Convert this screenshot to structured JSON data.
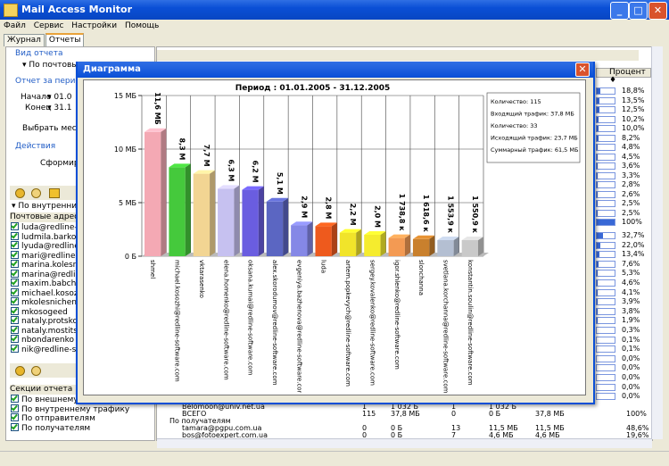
{
  "window": {
    "title": "Mail Access Monitor"
  },
  "menu": [
    "Файл",
    "Сервис",
    "Настройки",
    "Помощь"
  ],
  "tabs": [
    {
      "label": "Журнал"
    },
    {
      "label": "Отчеты"
    }
  ],
  "left": {
    "report_type_header": "Вид отчета",
    "report_type_value": "По почтовым",
    "period_header": "Отчет за период",
    "start_label": "Начало",
    "start_value": "01.0",
    "end_label": "Конец",
    "end_value": "31.1",
    "choose_month": "Выбрать месяц",
    "actions_header": "Действия",
    "generate": "Сформиров",
    "filter_value": "По внутренни",
    "addresses_header": "Почтовые адреса",
    "addresses": [
      "luda@redline-s",
      "ludmila.barkov",
      "lyuda@redline-s",
      "mari@redline-s",
      "marina.kolesnic",
      "marina@redline-",
      "maxim.babcher",
      "michael.kosozh",
      "mkolesnichenko",
      "mkosogeed",
      "nataly.protsko",
      "nataly.mostits",
      "nbondarenko",
      "nik@redline-so"
    ],
    "sections_header": "Секции отчета",
    "sections": [
      "По внешнему",
      "По внутреннему трафику",
      "По отправителям",
      "По получателям"
    ]
  },
  "right": {
    "percent_header": "Процент",
    "percents_top": [
      "18,8%",
      "13,5%",
      "12,5%",
      "10,2%",
      "10,0%",
      "8,2%",
      "4,8%",
      "4,5%",
      "3,6%",
      "3,3%",
      "2,8%",
      "2,6%",
      "2,5%",
      "2,5%",
      "100%"
    ],
    "percent_fills_top": [
      0.188,
      0.135,
      0.125,
      0.102,
      0.1,
      0.082,
      0.048,
      0.045,
      0.036,
      0.033,
      0.028,
      0.026,
      0.025,
      0.025,
      1.0
    ],
    "percents_mid": [
      "32,7%",
      "22,0%",
      "13,4%",
      "7,6%",
      "5,3%",
      "4,6%",
      "4,1%",
      "3,9%",
      "3,8%",
      "1,9%",
      "0,3%",
      "0,1%",
      "0,1%",
      "0,0%",
      "0,0%",
      "0,0%",
      "0,0%",
      "0,0%"
    ],
    "percent_fills_mid": [
      0.327,
      0.22,
      0.134,
      0.076,
      0.053,
      0.046,
      0.041,
      0.039,
      0.038,
      0.019,
      0.003,
      0.001,
      0.001,
      0,
      0,
      0,
      0,
      0
    ],
    "bottom_rows": [
      {
        "name": "Belomoon@univ.net.ua",
        "c1": "1",
        "c2": "1 032 Б",
        "c3": "1",
        "c4": "1 032 Б",
        "pct": ""
      },
      {
        "name": "ВСЕГО",
        "c1": "115",
        "c2": "37,8 МБ",
        "c3": "0",
        "c4": "0 Б",
        "c5": "37,8 МБ",
        "pct": "100%"
      },
      {
        "name": "По получателям",
        "c1": "",
        "c2": "",
        "c3": "",
        "c4": "",
        "pct": ""
      },
      {
        "name": "tamara@pgpu.com.ua",
        "c1": "0",
        "c2": "0 Б",
        "c3": "13",
        "c4": "11,5 МБ",
        "c5": "11,5 МБ",
        "pct": "48,6%"
      },
      {
        "name": "bos@fotoexpert.com.ua",
        "c1": "0",
        "c2": "0 Б",
        "c3": "7",
        "c4": "4,6 МБ",
        "c5": "4,6 МБ",
        "pct": "19,6%"
      }
    ]
  },
  "dialog": {
    "title": "Диаграмма"
  },
  "chart_data": {
    "type": "bar",
    "title": "Период : 01.01.2005 - 31.12.2005",
    "ylim": [
      0,
      15
    ],
    "yticks": [
      "0 Б",
      "5 МБ",
      "10 МБ",
      "15 МБ"
    ],
    "ytick_values": [
      0,
      5,
      10,
      15
    ],
    "grid": true,
    "categories": [
      "shmel",
      "michael.kosozhi@redline-software.com",
      "vktarasenko",
      "elena.homenko@redline-software.com",
      "oksana.kumai@redline-software.com",
      "alex.skorodumov@redline-software.com",
      "evgeniya.bazhenova@redline-software.com",
      "luda",
      "artem.popkevych@redline-software.com",
      "sergey.kovalenko@redline-software.com",
      "igor.shlenko@redline-software.com",
      "slonchanna",
      "svetlana.korchanna@redline-software.com",
      "konstantin.soulin@redline-software.com"
    ],
    "values": [
      11.6,
      8.3,
      7.7,
      6.3,
      6.2,
      5.1,
      2.9,
      2.8,
      2.2,
      2.0,
      1.7,
      1.6,
      1.5,
      1.5
    ],
    "labels": [
      "11,6 МБ",
      "8,3 М",
      "7,7 М",
      "6,3 М",
      "6,2 М",
      "5,1 М",
      "2,9 М",
      "2,8 М",
      "2,2 М",
      "2,0 М",
      "1 738,8 к",
      "1 618,6 к",
      "1 553,9 к",
      "1 550,9 к"
    ],
    "colors": [
      "#f4a9b4",
      "#45c93c",
      "#f2d593",
      "#c6c1f0",
      "#6a5de0",
      "#5b66c2",
      "#8588e6",
      "#ee5a1d",
      "#f1e42a",
      "#f5ec2e",
      "#f39a53",
      "#c9802d",
      "#b4bfd2",
      "#c9c9c9"
    ],
    "legend": [
      "Количество: 115",
      "Входящий трафик: 37,8 МБ",
      "Количество: 33",
      "Исходящий трафик: 23,7 МБ",
      "Суммарный трафик: 61,5 МБ"
    ],
    "legend_position": "top-right"
  }
}
